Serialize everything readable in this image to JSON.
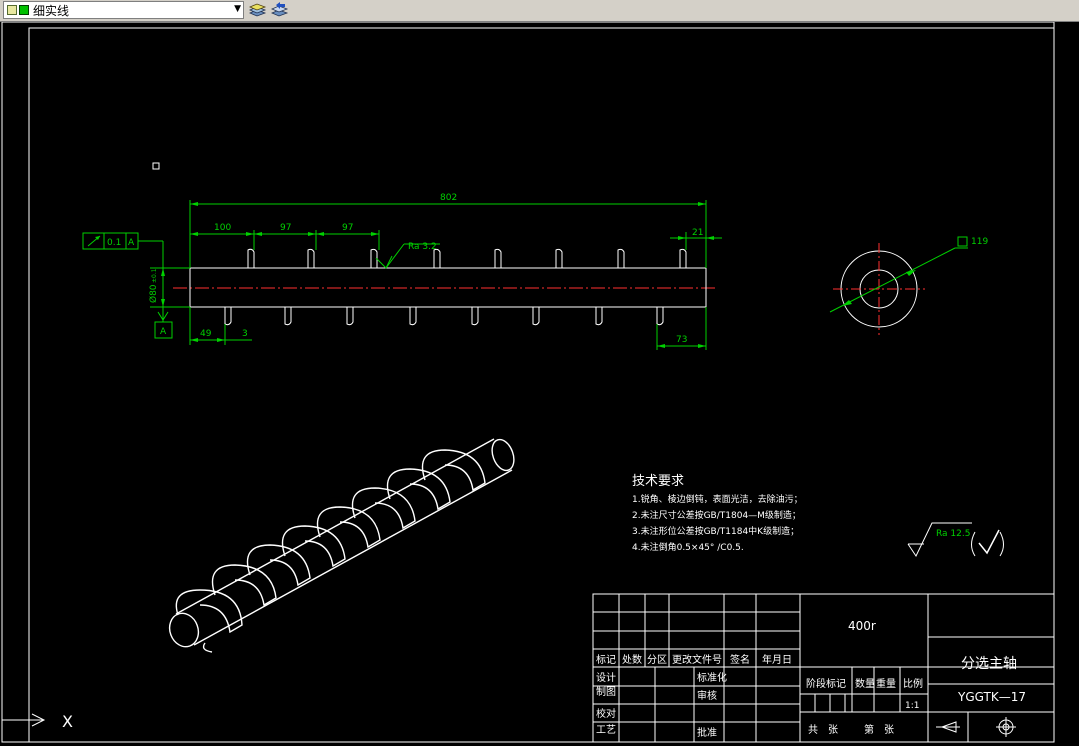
{
  "toolbar": {
    "linetype_label": "细实线"
  },
  "dims": {
    "total": "802",
    "d1": "100",
    "d2": "97",
    "d3": "97",
    "d4": "21",
    "d5": "49",
    "d6": "3",
    "d7": "73",
    "dia_left": "Ø80",
    "dia_tol": "±0.1",
    "section_dia": "119",
    "roughness": "Ra 3.2"
  },
  "tolerance": {
    "value": "0.1",
    "datum": "A",
    "datum_label": "A"
  },
  "tech": {
    "title": "技术要求",
    "line1": "1.锐角、棱边倒钝，表面光洁，去除油污；",
    "line2": "2.未注尺寸公差按GB/T1804—M级制造；",
    "line3": "3.未注形位公差按GB/T1184中K级制造；",
    "line4": "4.未注倒角0.5×45° /C0.5."
  },
  "roughness_default": "Ra 12.5",
  "title_block": {
    "material": "400r",
    "part_name": "分选主轴",
    "drawing_no": "YGGTK—17",
    "scale": "1:1",
    "h_mark": "标记",
    "h_count": "处数",
    "h_zone": "分区",
    "h_doc": "更改文件号",
    "h_sign": "签名",
    "h_date": "年月日",
    "r_design": "设计",
    "r_draw": "制图",
    "r_check": "校对",
    "r_process": "工艺",
    "std": "标准化",
    "review": "审核",
    "approve": "批准",
    "stage": "阶段标记",
    "qty": "数量",
    "weight": "重量",
    "ratio": "比例",
    "total_sheets": "共",
    "sheet_unit1": "张",
    "sheet_no": "第",
    "sheet_unit2": "张"
  },
  "ucs": {
    "x_label": "X"
  }
}
